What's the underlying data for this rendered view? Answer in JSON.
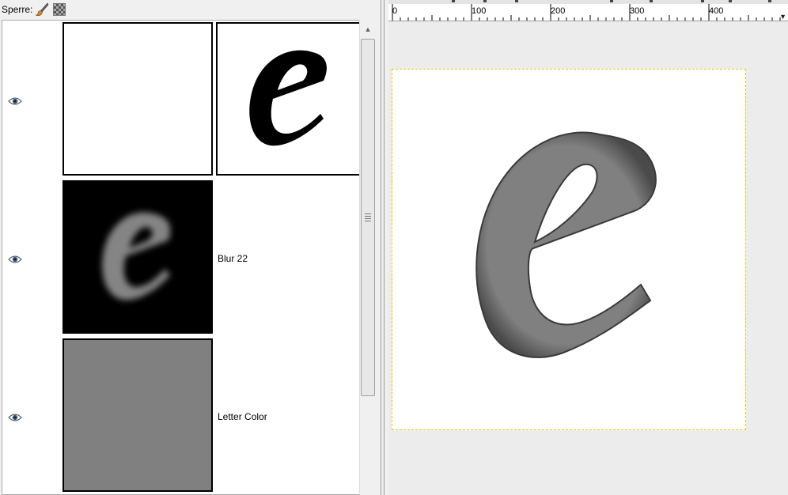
{
  "lock_bar": {
    "label": "Sperre:",
    "icons": [
      "paintbrush-lock-icon",
      "alpha-lock-icon"
    ]
  },
  "layers": [
    {
      "name": "",
      "visible": true,
      "mask": true,
      "thumbnail": "white-layer-with-black-e-mask"
    },
    {
      "name": "Blur 22",
      "visible": true,
      "mask": false,
      "thumbnail": "blurred-e-on-black"
    },
    {
      "name": "Letter Color",
      "visible": true,
      "mask": false,
      "thumbnail": "solid-gray"
    }
  ],
  "ruler": {
    "labels": [
      "0",
      "100",
      "200",
      "300",
      "400"
    ]
  },
  "colors": {
    "letter_fill": "#808080",
    "panel_bg": "#f0f0f0",
    "canvas_bg": "#ececec"
  }
}
